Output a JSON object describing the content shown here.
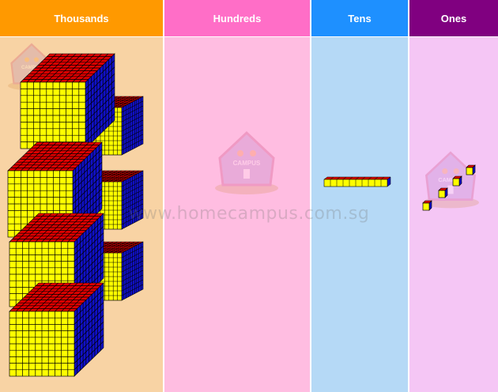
{
  "columns": [
    {
      "key": "thousands",
      "label": "Thousands",
      "header_color": "#FF9900",
      "body_color": "#F8D3A4",
      "count": 4
    },
    {
      "key": "hundreds",
      "label": "Hundreds",
      "header_color": "#FF6EC7",
      "body_color": "#FFBDE1",
      "count": 0
    },
    {
      "key": "tens",
      "label": "Tens",
      "header_color": "#1E90FF",
      "body_color": "#B5D9F6",
      "count": 1
    },
    {
      "key": "ones",
      "label": "Ones",
      "header_color": "#800080",
      "body_color": "#F5C6F5",
      "count": 4
    }
  ],
  "block_colors": {
    "front": "#FFFF00",
    "top": "#E00000",
    "side": "#1010C8",
    "grid": "#000000"
  },
  "watermark": "www.homecampus.com.sg",
  "logo_text": [
    "CAMPUS"
  ]
}
